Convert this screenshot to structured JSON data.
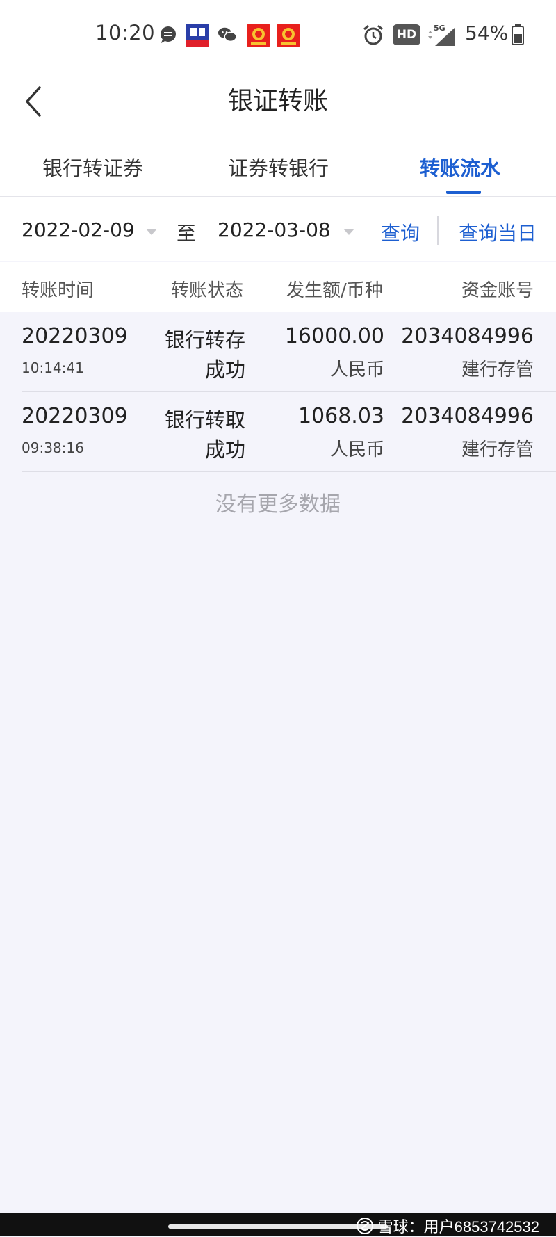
{
  "status_bar": {
    "time": "10:20",
    "battery": "54%",
    "hd_label": "HD",
    "network": "5G",
    "notification_icons": [
      "message-icon",
      "tuanzhang-app-icon",
      "wechat-icon",
      "securities-app-icon",
      "securities-app-icon"
    ]
  },
  "nav": {
    "title": "银证转账"
  },
  "tabs": [
    {
      "label": "银行转证券",
      "active": false
    },
    {
      "label": "证券转银行",
      "active": false
    },
    {
      "label": "转账流水",
      "active": true
    }
  ],
  "filter": {
    "start_date": "2022-02-09",
    "separator": "至",
    "end_date": "2022-03-08",
    "query_label": "查询",
    "query_today_label": "查询当日"
  },
  "table": {
    "headers": {
      "time": "转账时间",
      "status": "转账状态",
      "amount": "发生额/币种",
      "account": "资金账号"
    },
    "rows": [
      {
        "date": "20220309",
        "time": "10:14:41",
        "type": "银行转存",
        "result": "成功",
        "amount": "16000.00",
        "currency": "人民币",
        "account": "2034084996",
        "bank": "建行存管"
      },
      {
        "date": "20220309",
        "time": "09:38:16",
        "type": "银行转取",
        "result": "成功",
        "amount": "1068.03",
        "currency": "人民币",
        "account": "2034084996",
        "bank": "建行存管"
      }
    ],
    "empty_hint": "没有更多数据"
  },
  "watermark": "雪球：用户6853742532",
  "colors": {
    "accent": "#1d5fd1",
    "background": "#f4f4fb",
    "surface": "#ffffff"
  }
}
